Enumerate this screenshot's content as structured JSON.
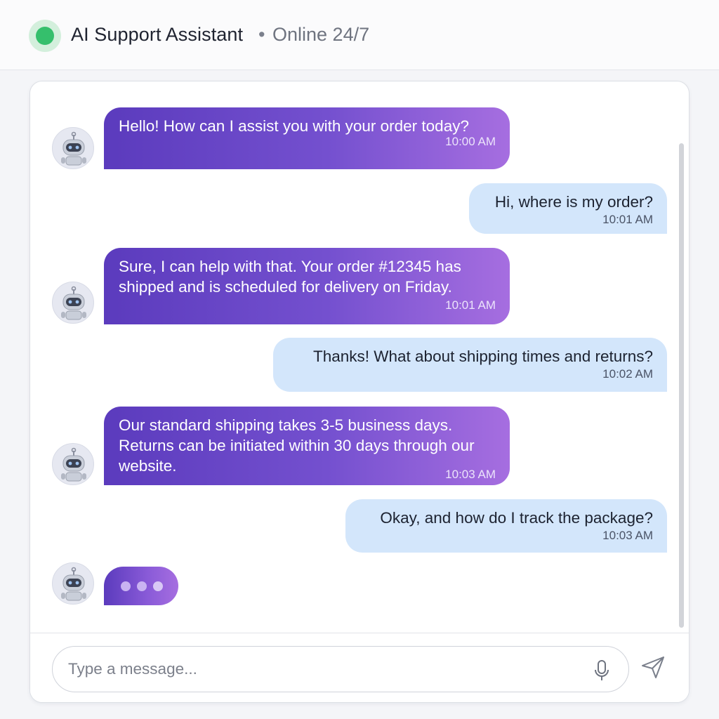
{
  "header": {
    "title": "AI Support Assistant",
    "separator": "•",
    "status": "Online 24/7",
    "status_color": "#35bf6c"
  },
  "messages": [
    {
      "sender": "bot",
      "text": "Hello! How can I assist you with your order today?",
      "time": "10:00 AM"
    },
    {
      "sender": "user",
      "text": "Hi, where is my order?",
      "time": "10:01 AM"
    },
    {
      "sender": "bot",
      "text": "Sure, I can help with that. Your order #12345 has shipped and is scheduled for delivery on Friday.",
      "time": "10:01 AM"
    },
    {
      "sender": "user",
      "text": "Thanks! What about shipping times and returns?",
      "time": "10:02 AM"
    },
    {
      "sender": "bot",
      "text": "Our standard shipping takes 3-5 business days. Returns can be initiated within 30 days through our website.",
      "time": "10:03 AM"
    },
    {
      "sender": "user",
      "text": "Okay, and how do I track the package?",
      "time": "10:03 AM"
    }
  ],
  "typing_indicator": {
    "dots": 3
  },
  "composer": {
    "placeholder": "Type a message...",
    "value": "",
    "mic_icon": "microphone-icon",
    "send_icon": "send-icon"
  },
  "colors": {
    "bot_bubble_start": "#5b3bbd",
    "bot_bubble_end": "#a66ee0",
    "user_bubble": "#d3e6fb"
  }
}
